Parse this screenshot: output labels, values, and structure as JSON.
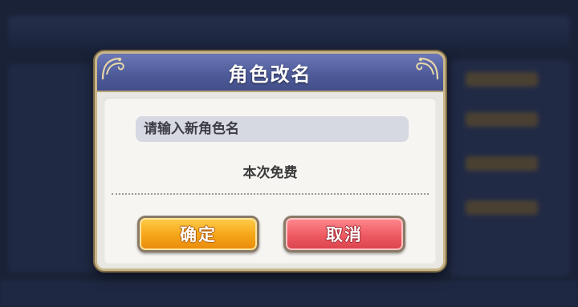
{
  "dialog": {
    "title": "角色改名",
    "input_placeholder": "请输入新角色名",
    "input_value": "",
    "cost_text": "本次免费",
    "confirm_label": "确定",
    "cancel_label": "取消"
  },
  "colors": {
    "header": "#5563a3",
    "confirm_button": "#f6a417",
    "cancel_button": "#ee5a62",
    "frame_gold": "#c9b68a"
  },
  "icons": {
    "corner_left": "ornament-corner-icon",
    "corner_right": "ornament-corner-icon"
  }
}
